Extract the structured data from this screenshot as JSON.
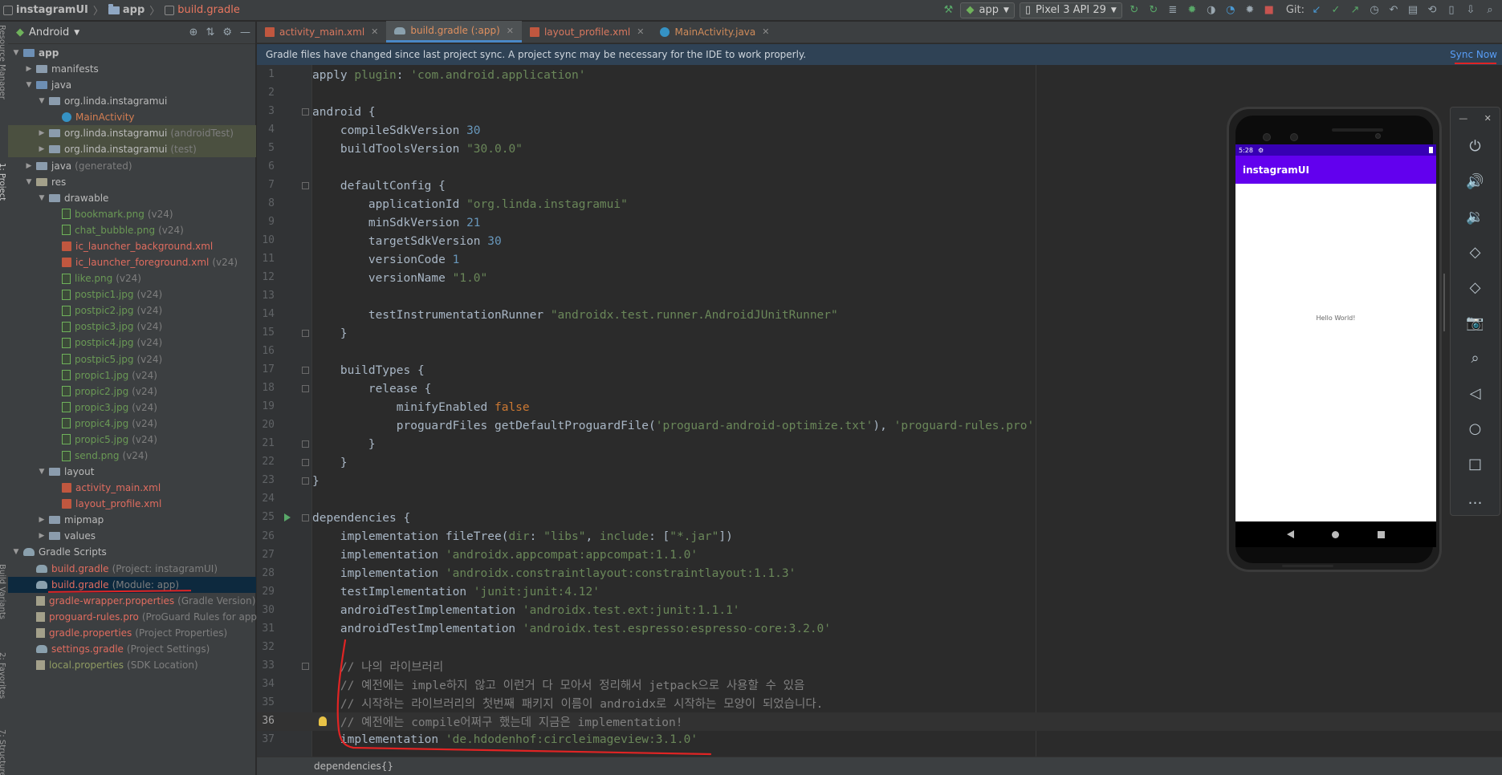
{
  "breadcrumbs": [
    {
      "label": "instagramUI"
    },
    {
      "label": "app"
    },
    {
      "label": "build.gradle"
    }
  ],
  "toolbar": {
    "run_config": "app",
    "device": "Pixel 3 API 29",
    "git_label": "Git:"
  },
  "project_panel": {
    "view_selector": "Android"
  },
  "tree": [
    {
      "label": "app",
      "suffix": "",
      "indent": 0,
      "twisty": "▼",
      "icon": "folder-blue",
      "color": "white",
      "bold": true
    },
    {
      "label": "manifests",
      "suffix": "",
      "indent": 1,
      "twisty": "▶",
      "icon": "folder",
      "color": "white"
    },
    {
      "label": "java",
      "suffix": "",
      "indent": 1,
      "twisty": "▼",
      "icon": "folder-blue",
      "color": "white"
    },
    {
      "label": "org.linda.instagramui",
      "suffix": "",
      "indent": 2,
      "twisty": "▼",
      "icon": "pkg",
      "color": "white"
    },
    {
      "label": "MainActivity",
      "suffix": "",
      "indent": 3,
      "twisty": "",
      "icon": "cls",
      "color": "orange"
    },
    {
      "label": "org.linda.instagramui",
      "suffix": "(androidTest)",
      "indent": 2,
      "twisty": "▶",
      "icon": "pkg",
      "color": "white",
      "alt": true
    },
    {
      "label": "org.linda.instagramui",
      "suffix": "(test)",
      "indent": 2,
      "twisty": "▶",
      "icon": "pkg",
      "color": "white",
      "alt": true
    },
    {
      "label": "java",
      "suffix": "(generated)",
      "indent": 1,
      "twisty": "▶",
      "icon": "folder",
      "color": "white"
    },
    {
      "label": "res",
      "suffix": "",
      "indent": 1,
      "twisty": "▼",
      "icon": "res",
      "color": "white"
    },
    {
      "label": "drawable",
      "suffix": "",
      "indent": 2,
      "twisty": "▼",
      "icon": "folder",
      "color": "white"
    },
    {
      "label": "bookmark.png",
      "suffix": "(v24)",
      "indent": 3,
      "twisty": "",
      "icon": "img",
      "color": "green"
    },
    {
      "label": "chat_bubble.png",
      "suffix": "(v24)",
      "indent": 3,
      "twisty": "",
      "icon": "img",
      "color": "green"
    },
    {
      "label": "ic_launcher_background.xml",
      "suffix": "",
      "indent": 3,
      "twisty": "",
      "icon": "xml",
      "color": "red"
    },
    {
      "label": "ic_launcher_foreground.xml",
      "suffix": "(v24)",
      "indent": 3,
      "twisty": "",
      "icon": "xml",
      "color": "red"
    },
    {
      "label": "like.png",
      "suffix": "(v24)",
      "indent": 3,
      "twisty": "",
      "icon": "img",
      "color": "green"
    },
    {
      "label": "postpic1.jpg",
      "suffix": "(v24)",
      "indent": 3,
      "twisty": "",
      "icon": "img",
      "color": "green"
    },
    {
      "label": "postpic2.jpg",
      "suffix": "(v24)",
      "indent": 3,
      "twisty": "",
      "icon": "img",
      "color": "green"
    },
    {
      "label": "postpic3.jpg",
      "suffix": "(v24)",
      "indent": 3,
      "twisty": "",
      "icon": "img",
      "color": "green"
    },
    {
      "label": "postpic4.jpg",
      "suffix": "(v24)",
      "indent": 3,
      "twisty": "",
      "icon": "img",
      "color": "green"
    },
    {
      "label": "postpic5.jpg",
      "suffix": "(v24)",
      "indent": 3,
      "twisty": "",
      "icon": "img",
      "color": "green"
    },
    {
      "label": "propic1.jpg",
      "suffix": "(v24)",
      "indent": 3,
      "twisty": "",
      "icon": "img",
      "color": "green"
    },
    {
      "label": "propic2.jpg",
      "suffix": "(v24)",
      "indent": 3,
      "twisty": "",
      "icon": "img",
      "color": "green"
    },
    {
      "label": "propic3.jpg",
      "suffix": "(v24)",
      "indent": 3,
      "twisty": "",
      "icon": "img",
      "color": "green"
    },
    {
      "label": "propic4.jpg",
      "suffix": "(v24)",
      "indent": 3,
      "twisty": "",
      "icon": "img",
      "color": "green"
    },
    {
      "label": "propic5.jpg",
      "suffix": "(v24)",
      "indent": 3,
      "twisty": "",
      "icon": "img",
      "color": "green"
    },
    {
      "label": "send.png",
      "suffix": "(v24)",
      "indent": 3,
      "twisty": "",
      "icon": "img",
      "color": "green"
    },
    {
      "label": "layout",
      "suffix": "",
      "indent": 2,
      "twisty": "▼",
      "icon": "folder",
      "color": "white"
    },
    {
      "label": "activity_main.xml",
      "suffix": "",
      "indent": 3,
      "twisty": "",
      "icon": "xml",
      "color": "red"
    },
    {
      "label": "layout_profile.xml",
      "suffix": "",
      "indent": 3,
      "twisty": "",
      "icon": "xml",
      "color": "red"
    },
    {
      "label": "mipmap",
      "suffix": "",
      "indent": 2,
      "twisty": "▶",
      "icon": "folder",
      "color": "white"
    },
    {
      "label": "values",
      "suffix": "",
      "indent": 2,
      "twisty": "▶",
      "icon": "folder",
      "color": "white"
    },
    {
      "label": "Gradle Scripts",
      "suffix": "",
      "indent": 0,
      "twisty": "▼",
      "icon": "gscripts",
      "color": "white"
    },
    {
      "label": "build.gradle",
      "suffix": "(Project: instagramUI)",
      "indent": 1,
      "twisty": "",
      "icon": "gradle",
      "color": "red"
    },
    {
      "label": "build.gradle",
      "suffix": "(Module: app)",
      "indent": 1,
      "twisty": "",
      "icon": "gradle",
      "color": "red",
      "selected": true
    },
    {
      "label": "gradle-wrapper.properties",
      "suffix": "(Gradle Version)",
      "indent": 1,
      "twisty": "",
      "icon": "props",
      "color": "red"
    },
    {
      "label": "proguard-rules.pro",
      "suffix": "(ProGuard Rules for app)",
      "indent": 1,
      "twisty": "",
      "icon": "props",
      "color": "red"
    },
    {
      "label": "gradle.properties",
      "suffix": "(Project Properties)",
      "indent": 1,
      "twisty": "",
      "icon": "props",
      "color": "red"
    },
    {
      "label": "settings.gradle",
      "suffix": "(Project Settings)",
      "indent": 1,
      "twisty": "",
      "icon": "gradle",
      "color": "red"
    },
    {
      "label": "local.properties",
      "suffix": "(SDK Location)",
      "indent": 1,
      "twisty": "",
      "icon": "props",
      "color": "olive"
    }
  ],
  "tabs": [
    {
      "label": "activity_main.xml",
      "icon": "xml",
      "active": false
    },
    {
      "label": "build.gradle (:app)",
      "icon": "gradle",
      "active": true
    },
    {
      "label": "layout_profile.xml",
      "icon": "xml",
      "active": false
    },
    {
      "label": "MainActivity.java",
      "icon": "class",
      "active": false
    }
  ],
  "notification": {
    "message": "Gradle files have changed since last project sync. A project sync may be necessary for the IDE to work properly.",
    "action": "Sync Now"
  },
  "code_lines": [
    {
      "n": 1,
      "t": [
        [
          "apply ",
          "fn"
        ],
        [
          "plugin",
          "str"
        ],
        [
          ": ",
          "fn"
        ],
        [
          "'com.android.application'",
          "str"
        ]
      ]
    },
    {
      "n": 2,
      "t": []
    },
    {
      "n": 3,
      "t": [
        [
          "android {",
          "fn"
        ]
      ]
    },
    {
      "n": 4,
      "t": [
        [
          "    compileSdkVersion ",
          "fn"
        ],
        [
          "30",
          "num"
        ]
      ]
    },
    {
      "n": 5,
      "t": [
        [
          "    buildToolsVersion ",
          "fn"
        ],
        [
          "\"30.0.0\"",
          "str"
        ]
      ]
    },
    {
      "n": 6,
      "t": []
    },
    {
      "n": 7,
      "t": [
        [
          "    defaultConfig {",
          "fn"
        ]
      ]
    },
    {
      "n": 8,
      "t": [
        [
          "        applicationId ",
          "fn"
        ],
        [
          "\"org.linda.instagramui\"",
          "str"
        ]
      ]
    },
    {
      "n": 9,
      "t": [
        [
          "        minSdkVersion ",
          "fn"
        ],
        [
          "21",
          "num"
        ]
      ]
    },
    {
      "n": 10,
      "t": [
        [
          "        targetSdkVersion ",
          "fn"
        ],
        [
          "30",
          "num"
        ]
      ]
    },
    {
      "n": 11,
      "t": [
        [
          "        versionCode ",
          "fn"
        ],
        [
          "1",
          "num"
        ]
      ]
    },
    {
      "n": 12,
      "t": [
        [
          "        versionName ",
          "fn"
        ],
        [
          "\"1.0\"",
          "str"
        ]
      ]
    },
    {
      "n": 13,
      "t": []
    },
    {
      "n": 14,
      "t": [
        [
          "        testInstrumentationRunner ",
          "fn"
        ],
        [
          "\"androidx.test.runner.AndroidJUnitRunner\"",
          "str"
        ]
      ]
    },
    {
      "n": 15,
      "t": [
        [
          "    }",
          "fn"
        ]
      ]
    },
    {
      "n": 16,
      "t": []
    },
    {
      "n": 17,
      "t": [
        [
          "    buildTypes {",
          "fn"
        ]
      ]
    },
    {
      "n": 18,
      "t": [
        [
          "        release {",
          "fn"
        ]
      ]
    },
    {
      "n": 19,
      "t": [
        [
          "            minifyEnabled ",
          "fn"
        ],
        [
          "false",
          "kw"
        ]
      ]
    },
    {
      "n": 20,
      "t": [
        [
          "            proguardFiles getDefaultProguardFile(",
          "fn"
        ],
        [
          "'proguard-android-optimize.txt'",
          "str"
        ],
        [
          "), ",
          "fn"
        ],
        [
          "'proguard-rules.pro'",
          "str"
        ]
      ]
    },
    {
      "n": 21,
      "t": [
        [
          "        }",
          "fn"
        ]
      ]
    },
    {
      "n": 22,
      "t": [
        [
          "    }",
          "fn"
        ]
      ]
    },
    {
      "n": 23,
      "t": [
        [
          "}",
          "fn"
        ]
      ]
    },
    {
      "n": 24,
      "t": []
    },
    {
      "n": 25,
      "t": [
        [
          "dependencies {",
          "fn"
        ]
      ]
    },
    {
      "n": 26,
      "t": [
        [
          "    implementation fileTree(",
          "fn"
        ],
        [
          "dir",
          "str"
        ],
        [
          ": ",
          "fn"
        ],
        [
          "\"libs\"",
          "str"
        ],
        [
          ", ",
          "fn"
        ],
        [
          "include",
          "str"
        ],
        [
          ": [",
          "fn"
        ],
        [
          "\"*.jar\"",
          "str"
        ],
        [
          "])",
          "fn"
        ]
      ]
    },
    {
      "n": 27,
      "t": [
        [
          "    implementation ",
          "fn"
        ],
        [
          "'androidx.appcompat:appcompat:1.1.0'",
          "str"
        ]
      ]
    },
    {
      "n": 28,
      "t": [
        [
          "    implementation ",
          "fn"
        ],
        [
          "'androidx.constraintlayout:constraintlayout:1.1.3'",
          "str"
        ]
      ]
    },
    {
      "n": 29,
      "t": [
        [
          "    testImplementation ",
          "fn"
        ],
        [
          "'junit:junit:4.12'",
          "str"
        ]
      ]
    },
    {
      "n": 30,
      "t": [
        [
          "    androidTestImplementation ",
          "fn"
        ],
        [
          "'androidx.test.ext:junit:1.1.1'",
          "str"
        ]
      ]
    },
    {
      "n": 31,
      "t": [
        [
          "    androidTestImplementation ",
          "fn"
        ],
        [
          "'androidx.test.espresso:espresso-core:3.2.0'",
          "str"
        ]
      ]
    },
    {
      "n": 32,
      "t": []
    },
    {
      "n": 33,
      "t": [
        [
          "    // 나의 라이브러리",
          "cm"
        ]
      ]
    },
    {
      "n": 34,
      "t": [
        [
          "    // 예전에는 imple하지 않고 이런거 다 모아서 정리해서 jetpack으로 사용할 수 있음",
          "cm"
        ]
      ]
    },
    {
      "n": 35,
      "t": [
        [
          "    // 시작하는 라이브러리의 첫번째 패키지 이름이 androidx로 시작하는 모양이 되었습니다.",
          "cm"
        ]
      ]
    },
    {
      "n": 36,
      "t": [
        [
          "    // 예전에는 compile어쩌구 했는데 지금은 implementation!",
          "cm"
        ]
      ],
      "current": true
    },
    {
      "n": 37,
      "t": [
        [
          "    implementation ",
          "fn"
        ],
        [
          "'de.hdodenhof:circleimageview:3.1.0'",
          "str"
        ]
      ]
    }
  ],
  "bottom_breadcrumb": "dependencies{}",
  "emulator": {
    "status_time": "5:28",
    "app_title": "instagramUI",
    "content_text": "Hello World!",
    "side_buttons": [
      "power-icon",
      "volume-up-icon",
      "volume-down-icon",
      "rotate-left-icon",
      "rotate-right-icon",
      "camera-icon",
      "zoom-icon",
      "back-icon",
      "home-icon",
      "overview-icon",
      "more-icon"
    ]
  },
  "colors": {
    "annotation": "#e02424",
    "accent_primary": "#6200ee",
    "accent_dark": "#3700b3"
  }
}
